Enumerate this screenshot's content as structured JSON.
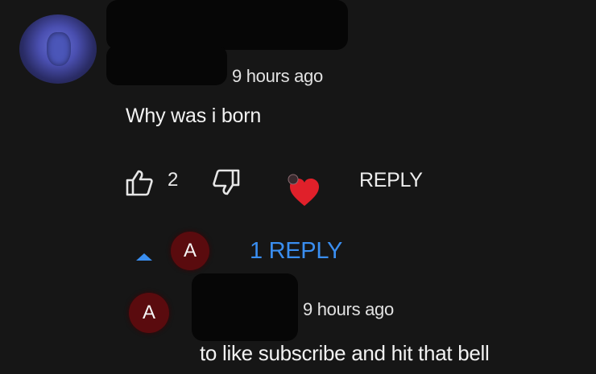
{
  "comment": {
    "timestamp": "9 hours ago",
    "text": "Why was i born",
    "like_count": "2",
    "reply_label": "REPLY",
    "icons": {
      "like": "thumbs-up-icon",
      "dislike": "thumbs-down-icon",
      "creator_heart": "heart-icon"
    }
  },
  "replies_toggle": {
    "avatar_letter": "A",
    "label": "1 REPLY",
    "icon": "caret-up-icon"
  },
  "reply": {
    "avatar_letter": "A",
    "timestamp": "9 hours ago",
    "text": "to like subscribe and hit that bell"
  },
  "colors": {
    "background": "#161616",
    "link_blue": "#3a8ef0",
    "heart_red": "#e0202a",
    "avatar_red": "#5a0b0e"
  }
}
